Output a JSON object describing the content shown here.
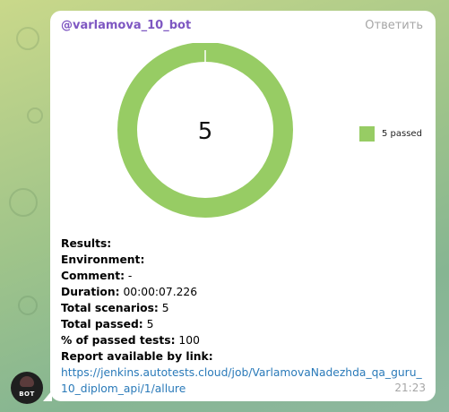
{
  "message": {
    "sender": "@varlamova_10_bot",
    "reply_label": "Ответить",
    "time": "21:23",
    "avatar_text": "BOT"
  },
  "chart_data": {
    "type": "pie",
    "style": "donut",
    "center_label": "5",
    "slices": [
      {
        "label": "5 passed",
        "value": 5,
        "color": "#97cc64"
      }
    ],
    "legend_placement": "right",
    "legend": [
      "5 passed"
    ]
  },
  "report": {
    "results_label": "Results:",
    "environment_label": "Environment:",
    "comment_label": "Comment:",
    "comment_value": "-",
    "duration_label": "Duration:",
    "duration_value": "00:00:07.226",
    "total_scenarios_label": "Total scenarios:",
    "total_scenarios_value": "5",
    "total_passed_label": "Total passed:",
    "total_passed_value": "5",
    "percent_label": "% of passed tests:",
    "percent_value": "100",
    "link_label": "Report available by link:",
    "link_text": "https://jenkins.autotests.cloud/job/VarlamovaNadezhda_qa_guru_10_diplom_api/1/allure"
  },
  "colors": {
    "sender": "#7e57c2",
    "link": "#2a7ab9",
    "passed": "#97cc64",
    "bubble": "#ffffff"
  }
}
